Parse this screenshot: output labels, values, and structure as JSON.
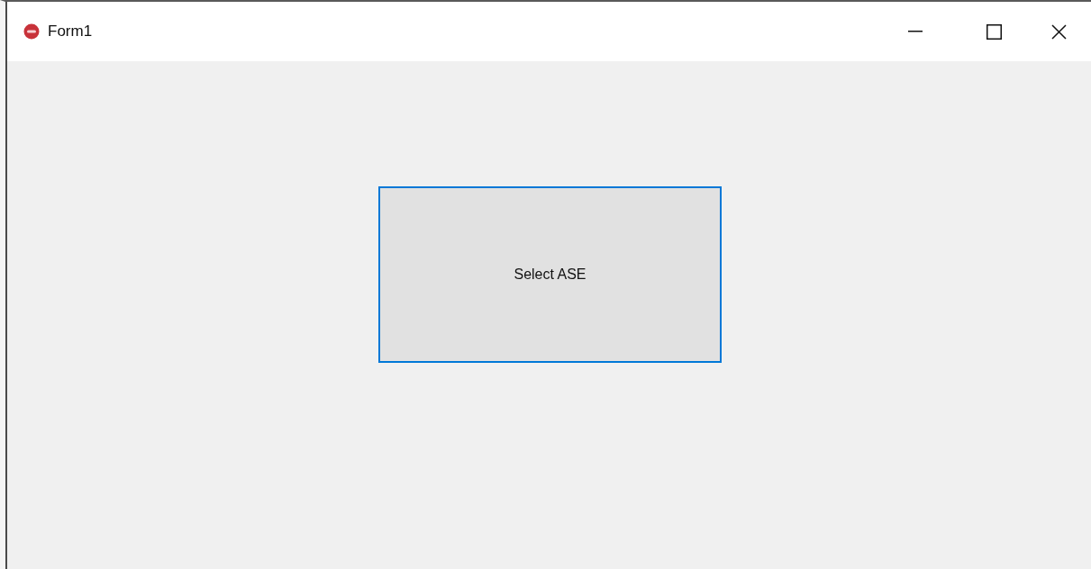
{
  "window": {
    "title": "Form1"
  },
  "button": {
    "label": "Select ASE",
    "focused": true
  }
}
